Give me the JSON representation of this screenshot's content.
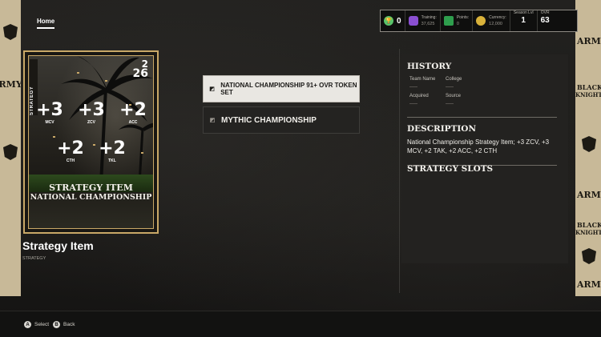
{
  "nav": {
    "home_label": "Home"
  },
  "stats": {
    "trophy_count": "0",
    "training_label": "Training:",
    "training_value": "37,625",
    "points_label": "Points:",
    "points_value": "0",
    "currency_label": "Currency:",
    "currency_value": "12,000",
    "season_label": "Season Lvl",
    "season_value": "1",
    "ovr_label": "OVR",
    "ovr_value": "63"
  },
  "card": {
    "side_label": "STRATEGY",
    "year_top": "2",
    "year_bottom": "26",
    "attributes": [
      {
        "value": "+3",
        "name": "MCV"
      },
      {
        "value": "+3",
        "name": "ZCV"
      },
      {
        "value": "+2",
        "name": "ACC"
      },
      {
        "value": "+2",
        "name": "CTH"
      },
      {
        "value": "+2",
        "name": "TKL"
      }
    ],
    "title_line1": "STRATEGY ITEM",
    "title_line2": "NATIONAL CHAMPIONSHIP"
  },
  "item": {
    "title": "Strategy Item",
    "subtitle": "STRATEGY"
  },
  "list": [
    {
      "label": "NATIONAL CHAMPIONSHIP 91+ OVR TOKEN SET",
      "selected": true
    },
    {
      "label": "MYTHIC CHAMPIONSHIP",
      "selected": false
    }
  ],
  "panel": {
    "history_heading": "HISTORY",
    "team_name_label": "Team Name",
    "team_name_value": "-----",
    "college_label": "College",
    "college_value": "-----",
    "acquired_label": "Acquired",
    "acquired_value": "-----",
    "source_label": "Source",
    "source_value": "-----",
    "description_heading": "DESCRIPTION",
    "description_text": "National Championship Strategy Item; +3 ZCV, +3 MCV, +2 TAK, +2 ACC, +2 CTH",
    "slots_heading": "STRATEGY SLOTS"
  },
  "banners": {
    "army": "ARMY",
    "black": "BLACK",
    "knights": "KNIGHTS"
  },
  "footer": {
    "select_button": "A",
    "select_label": "Select",
    "back_button": "B",
    "back_label": "Back"
  },
  "colors": {
    "gold": "#c9a867",
    "selected_bg": "#e9e7e2",
    "panel_bg": "#232220"
  }
}
